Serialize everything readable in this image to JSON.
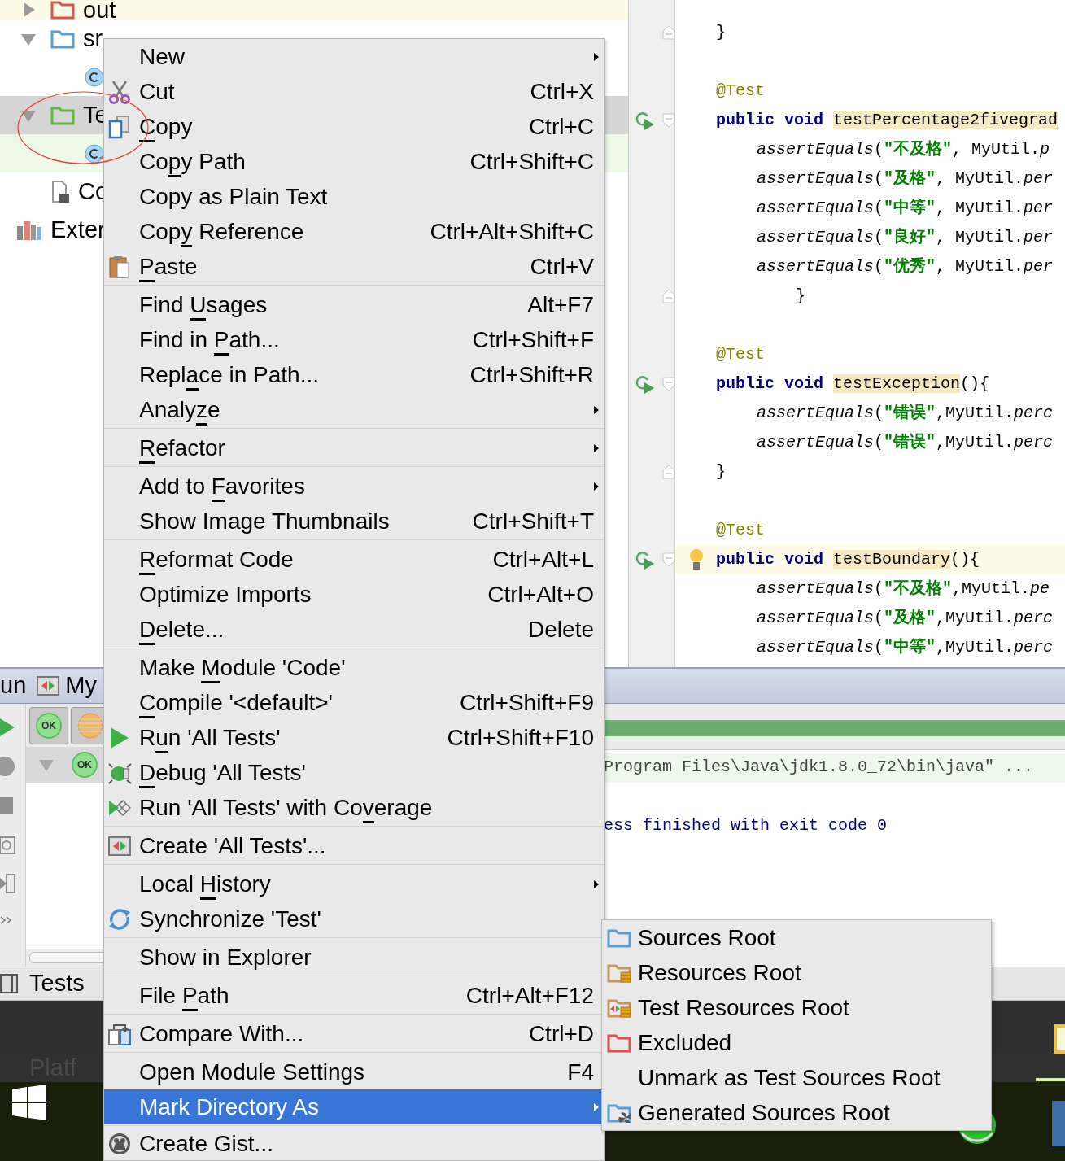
{
  "project_tree": [
    {
      "children": [
        {
          "kind": "excluded-folder",
          "label": "out",
          "expanded": false,
          "selected": false,
          "color": "#fdfbe6"
        },
        {
          "kind": "source-folder",
          "label": "sr",
          "expanded": true,
          "selected": false,
          "children": [
            {
              "kind": "class",
              "selected": false
            }
          ]
        },
        {
          "kind": "test-folder",
          "label": "Te",
          "expanded": true,
          "selected": true,
          "children": [
            {
              "kind": "test-class",
              "selected": false,
              "color": "#eef9e8"
            }
          ]
        },
        {
          "kind": "file",
          "label": "Co",
          "selected": false
        }
      ]
    },
    {
      "kind": "library",
      "label": "Exter",
      "selected": false
    }
  ],
  "editor": {
    "blocks": [
      [
        {
          "kind": "member",
          "current": false,
          "gutter": [
            {
              "kind": "fold-end"
            }
          ],
          "tokens": [
            {
              "kind": "plain",
              "text": "}"
            }
          ]
        }
      ],
      [
        {
          "kind": "member",
          "current": false,
          "tokens": [
            {
              "kind": "annotation",
              "text": "@Test"
            }
          ]
        },
        {
          "kind": "member",
          "current": false,
          "gutter": [
            {
              "kind": "run"
            },
            {
              "kind": "fold-start"
            }
          ],
          "tokens": [
            {
              "kind": "keyword",
              "text": "public void "
            },
            {
              "kind": "method",
              "text": "testPercentage2fivegrad"
            }
          ]
        },
        {
          "kind": "statement",
          "current": false,
          "tokens": [
            {
              "kind": "static",
              "text": "assertEquals"
            },
            {
              "kind": "plain",
              "text": "("
            },
            {
              "kind": "string",
              "text": "\"不及格\""
            },
            {
              "kind": "plain",
              "text": ", MyUtil."
            },
            {
              "kind": "static",
              "text": "p"
            }
          ]
        },
        {
          "kind": "statement",
          "current": false,
          "tokens": [
            {
              "kind": "static",
              "text": "assertEquals"
            },
            {
              "kind": "plain",
              "text": "("
            },
            {
              "kind": "string",
              "text": "\"及格\""
            },
            {
              "kind": "plain",
              "text": ", MyUtil."
            },
            {
              "kind": "static",
              "text": "per"
            }
          ]
        },
        {
          "kind": "statement",
          "current": false,
          "tokens": [
            {
              "kind": "static",
              "text": "assertEquals"
            },
            {
              "kind": "plain",
              "text": "("
            },
            {
              "kind": "string",
              "text": "\"中等\""
            },
            {
              "kind": "plain",
              "text": ", MyUtil."
            },
            {
              "kind": "static",
              "text": "per"
            }
          ]
        },
        {
          "kind": "statement",
          "current": false,
          "tokens": [
            {
              "kind": "static",
              "text": "assertEquals"
            },
            {
              "kind": "plain",
              "text": "("
            },
            {
              "kind": "string",
              "text": "\"良好\""
            },
            {
              "kind": "plain",
              "text": ", MyUtil."
            },
            {
              "kind": "static",
              "text": "per"
            }
          ]
        },
        {
          "kind": "statement",
          "current": false,
          "tokens": [
            {
              "kind": "static",
              "text": "assertEquals"
            },
            {
              "kind": "plain",
              "text": "("
            },
            {
              "kind": "string",
              "text": "\"优秀\""
            },
            {
              "kind": "plain",
              "text": ", MyUtil."
            },
            {
              "kind": "static",
              "text": "per"
            }
          ]
        },
        {
          "kind": "nested",
          "current": false,
          "gutter": [
            {
              "kind": "fold-end"
            }
          ],
          "tokens": [
            {
              "kind": "plain",
              "text": "}"
            }
          ]
        }
      ],
      [
        {
          "kind": "member",
          "current": false,
          "tokens": [
            {
              "kind": "annotation",
              "text": "@Test"
            }
          ]
        },
        {
          "kind": "member",
          "current": false,
          "gutter": [
            {
              "kind": "run"
            },
            {
              "kind": "fold-start"
            }
          ],
          "tokens": [
            {
              "kind": "keyword",
              "text": "public void "
            },
            {
              "kind": "method",
              "text": "testException"
            },
            {
              "kind": "plain",
              "text": "(){"
            }
          ]
        },
        {
          "kind": "statement",
          "current": false,
          "tokens": [
            {
              "kind": "static",
              "text": "assertEquals"
            },
            {
              "kind": "plain",
              "text": "("
            },
            {
              "kind": "string",
              "text": "\"错误\""
            },
            {
              "kind": "plain",
              "text": ",MyUtil."
            },
            {
              "kind": "static",
              "text": "perc"
            }
          ]
        },
        {
          "kind": "statement",
          "current": false,
          "tokens": [
            {
              "kind": "static",
              "text": "assertEquals"
            },
            {
              "kind": "plain",
              "text": "("
            },
            {
              "kind": "string",
              "text": "\"错误\""
            },
            {
              "kind": "plain",
              "text": ",MyUtil."
            },
            {
              "kind": "static",
              "text": "perc"
            }
          ]
        },
        {
          "kind": "member",
          "current": false,
          "gutter": [
            {
              "kind": "fold-end"
            }
          ],
          "tokens": [
            {
              "kind": "plain",
              "text": "}"
            }
          ]
        }
      ],
      [
        {
          "kind": "member",
          "current": false,
          "tokens": [
            {
              "kind": "annotation",
              "text": "@Test"
            }
          ]
        },
        {
          "kind": "member",
          "current": true,
          "gutter": [
            {
              "kind": "run"
            },
            {
              "kind": "fold-start"
            },
            {
              "kind": "bulb"
            }
          ],
          "tokens": [
            {
              "kind": "keyword",
              "text": "public void "
            },
            {
              "kind": "method",
              "text": "testBoundary"
            },
            {
              "kind": "plain",
              "text": "(){"
            }
          ]
        },
        {
          "kind": "statement",
          "current": false,
          "tokens": [
            {
              "kind": "static",
              "text": "assertEquals"
            },
            {
              "kind": "plain",
              "text": "("
            },
            {
              "kind": "string",
              "text": "\"不及格\""
            },
            {
              "kind": "plain",
              "text": ",MyUtil."
            },
            {
              "kind": "static",
              "text": "pe"
            }
          ]
        },
        {
          "kind": "statement",
          "current": false,
          "tokens": [
            {
              "kind": "static",
              "text": "assertEquals"
            },
            {
              "kind": "plain",
              "text": "("
            },
            {
              "kind": "string",
              "text": "\"及格\""
            },
            {
              "kind": "plain",
              "text": ",MyUtil."
            },
            {
              "kind": "static",
              "text": "perc"
            }
          ]
        },
        {
          "kind": "statement",
          "current": false,
          "tokens": [
            {
              "kind": "static",
              "text": "assertEquals"
            },
            {
              "kind": "plain",
              "text": "("
            },
            {
              "kind": "string",
              "text": "\"中等\""
            },
            {
              "kind": "plain",
              "text": ",MyUtil."
            },
            {
              "kind": "static",
              "text": "perc"
            }
          ]
        }
      ]
    ]
  },
  "run_panel": {
    "title": "un",
    "config_tab": "My",
    "toolbar": [
      {
        "kind": "show-passed",
        "badge": "OK",
        "selected": true
      },
      {
        "kind": "sort",
        "selected": true
      }
    ],
    "test_tree": [
      {
        "badge": "OK",
        "expanded": true,
        "selected": true
      }
    ],
    "progress": {
      "level": 1
    },
    "console": [
      {
        "kind": "command",
        "text": "Program Files\\Java\\jdk1.8.0_72\\bin\\java\" ..."
      },
      {
        "kind": "output",
        "text": "ess finished with exit code 0"
      }
    ]
  },
  "tests_bar": {
    "label": "Tests"
  },
  "taskbar": {
    "label": "Platf"
  },
  "context_menu": {
    "groups": [
      [
        {
          "label": "New",
          "kind": "plain",
          "submenu": true,
          "selected": false
        },
        {
          "label": "Cut",
          "kind": "cut",
          "shortcut": "Ctrl+X",
          "submenu": false,
          "selected": false
        },
        {
          "label_parts": [
            {
              "text": "C",
              "underlined": true
            },
            {
              "text": "opy",
              "underlined": false
            }
          ],
          "kind": "copy",
          "shortcut": "Ctrl+C",
          "submenu": false,
          "selected": false
        },
        {
          "label_parts": [
            {
              "text": "Co",
              "underlined": false
            },
            {
              "text": "p",
              "underlined": true
            },
            {
              "text": "y Path",
              "underlined": false
            }
          ],
          "kind": "plain",
          "shortcut": "Ctrl+Shift+C",
          "submenu": false,
          "selected": false
        },
        {
          "label": "Copy as Plain Text",
          "kind": "plain",
          "submenu": false,
          "selected": false
        },
        {
          "label_parts": [
            {
              "text": "Cop",
              "underlined": false
            },
            {
              "text": "y",
              "underlined": true
            },
            {
              "text": " Reference",
              "underlined": false
            }
          ],
          "kind": "plain",
          "shortcut": "Ctrl+Alt+Shift+C",
          "submenu": false,
          "selected": false
        },
        {
          "label_parts": [
            {
              "text": "P",
              "underlined": true
            },
            {
              "text": "aste",
              "underlined": false
            }
          ],
          "kind": "paste",
          "shortcut": "Ctrl+V",
          "submenu": false,
          "selected": false
        }
      ],
      [
        {
          "label_parts": [
            {
              "text": "Find ",
              "underlined": false
            },
            {
              "text": "U",
              "underlined": true
            },
            {
              "text": "sages",
              "underlined": false
            }
          ],
          "kind": "plain",
          "shortcut": "Alt+F7",
          "submenu": false,
          "selected": false
        },
        {
          "label_parts": [
            {
              "text": "Find in ",
              "underlined": false
            },
            {
              "text": "P",
              "underlined": true
            },
            {
              "text": "ath...",
              "underlined": false
            }
          ],
          "kind": "plain",
          "shortcut": "Ctrl+Shift+F",
          "submenu": false,
          "selected": false
        },
        {
          "label_parts": [
            {
              "text": "Repl",
              "underlined": false
            },
            {
              "text": "a",
              "underlined": true
            },
            {
              "text": "ce in Path...",
              "underlined": false
            }
          ],
          "kind": "plain",
          "shortcut": "Ctrl+Shift+R",
          "submenu": false,
          "selected": false
        },
        {
          "label_parts": [
            {
              "text": "Analy",
              "underlined": false
            },
            {
              "text": "z",
              "underlined": true
            },
            {
              "text": "e",
              "underlined": false
            }
          ],
          "kind": "plain",
          "submenu": true,
          "selected": false
        }
      ],
      [
        {
          "label_parts": [
            {
              "text": "R",
              "underlined": true
            },
            {
              "text": "efactor",
              "underlined": false
            }
          ],
          "kind": "plain",
          "submenu": true,
          "selected": false
        }
      ],
      [
        {
          "label_parts": [
            {
              "text": "Add to ",
              "underlined": false
            },
            {
              "text": "F",
              "underlined": true
            },
            {
              "text": "avorites",
              "underlined": false
            }
          ],
          "kind": "plain",
          "submenu": true,
          "selected": false
        },
        {
          "label": "Show Image Thumbnails",
          "kind": "plain",
          "shortcut": "Ctrl+Shift+T",
          "submenu": false,
          "selected": false
        }
      ],
      [
        {
          "label_parts": [
            {
              "text": "R",
              "underlined": true
            },
            {
              "text": "eformat Code",
              "underlined": false
            }
          ],
          "kind": "plain",
          "shortcut": "Ctrl+Alt+L",
          "submenu": false,
          "selected": false
        },
        {
          "label": "Optimize Imports",
          "kind": "plain",
          "shortcut": "Ctrl+Alt+O",
          "submenu": false,
          "selected": false
        },
        {
          "label_parts": [
            {
              "text": "D",
              "underlined": true
            },
            {
              "text": "elete...",
              "underlined": false
            }
          ],
          "kind": "plain",
          "shortcut": "Delete",
          "submenu": false,
          "selected": false
        }
      ],
      [
        {
          "label_parts": [
            {
              "text": "Make ",
              "underlined": false
            },
            {
              "text": "M",
              "underlined": true
            },
            {
              "text": "odule 'Code'",
              "underlined": false
            }
          ],
          "kind": "plain",
          "submenu": false,
          "selected": false
        },
        {
          "label_parts": [
            {
              "text": "C",
              "underlined": true
            },
            {
              "text": "ompile '<default>'",
              "underlined": false
            }
          ],
          "kind": "plain",
          "shortcut": "Ctrl+Shift+F9",
          "submenu": false,
          "selected": false
        },
        {
          "label_parts": [
            {
              "text": "R",
              "underlined": false
            },
            {
              "text": "u",
              "underlined": true
            },
            {
              "text": "n 'All Tests'",
              "underlined": false
            }
          ],
          "kind": "run",
          "shortcut": "Ctrl+Shift+F10",
          "submenu": false,
          "selected": false
        },
        {
          "label_parts": [
            {
              "text": "D",
              "underlined": true
            },
            {
              "text": "ebug 'All Tests'",
              "underlined": false
            }
          ],
          "kind": "debug",
          "submenu": false,
          "selected": false
        },
        {
          "label_parts": [
            {
              "text": "Run 'All Tests' with Co",
              "underlined": false
            },
            {
              "text": "v",
              "underlined": true
            },
            {
              "text": "erage",
              "underlined": false
            }
          ],
          "kind": "coverage",
          "submenu": false,
          "selected": false
        }
      ],
      [
        {
          "label": "Create 'All Tests'...",
          "kind": "run-config",
          "submenu": false,
          "selected": false
        }
      ],
      [
        {
          "label_parts": [
            {
              "text": "Local ",
              "underlined": false
            },
            {
              "text": "H",
              "underlined": true
            },
            {
              "text": "istory",
              "underlined": false
            }
          ],
          "kind": "plain",
          "submenu": true,
          "selected": false
        },
        {
          "label": "Synchronize 'Test'",
          "kind": "sync",
          "submenu": false,
          "selected": false
        }
      ],
      [
        {
          "label": "Show in Explorer",
          "kind": "plain",
          "submenu": false,
          "selected": false
        }
      ],
      [
        {
          "label_parts": [
            {
              "text": "File ",
              "underlined": false
            },
            {
              "text": "P",
              "underlined": true
            },
            {
              "text": "ath",
              "underlined": false
            }
          ],
          "kind": "plain",
          "shortcut": "Ctrl+Alt+F12",
          "submenu": false,
          "selected": false
        }
      ],
      [
        {
          "label": "Compare With...",
          "kind": "compare",
          "shortcut": "Ctrl+D",
          "submenu": false,
          "selected": false
        }
      ],
      [
        {
          "label": "Open Module Settings",
          "kind": "plain",
          "shortcut": "F4",
          "submenu": false,
          "selected": false
        },
        {
          "label": "Mark Directory As",
          "kind": "plain",
          "submenu": true,
          "selected": true
        }
      ],
      [
        {
          "label": "Create Gist...",
          "kind": "gist",
          "submenu": false,
          "selected": false
        }
      ]
    ]
  },
  "submenu": {
    "items": [
      {
        "label": "Sources Root",
        "kind": "sources",
        "selected": false
      },
      {
        "label": "Resources Root",
        "kind": "resources",
        "selected": false
      },
      {
        "label": "Test Resources Root",
        "kind": "test-resources",
        "selected": false
      },
      {
        "label": "Excluded",
        "kind": "excluded",
        "selected": false
      },
      {
        "label": "Unmark as Test Sources Root",
        "kind": "unmark",
        "selected": false
      },
      {
        "label": "Generated Sources Root",
        "kind": "generated",
        "selected": false
      }
    ]
  }
}
